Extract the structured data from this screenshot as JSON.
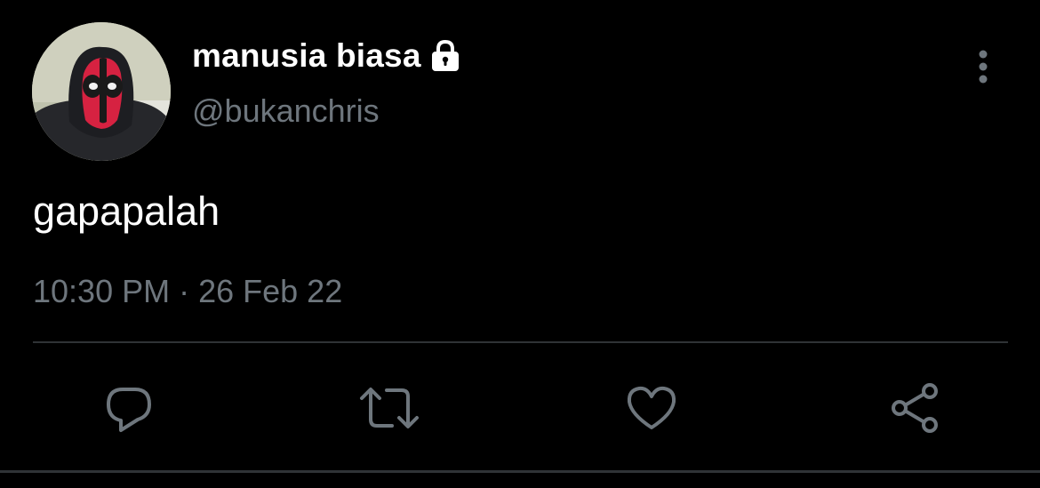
{
  "tweet": {
    "author": {
      "display_name": "manusia biasa",
      "handle": "@bukanchris",
      "verified_icon": "lock-icon",
      "avatar_icon": "avatar-image"
    },
    "text": "gapapalah",
    "time": "10:30 PM",
    "separator": " · ",
    "date": "26 Feb 22",
    "more_icon": "more-vertical-icon"
  },
  "actions": [
    {
      "name": "reply",
      "icon": "reply-icon"
    },
    {
      "name": "retweet",
      "icon": "retweet-icon"
    },
    {
      "name": "like",
      "icon": "heart-icon"
    },
    {
      "name": "share",
      "icon": "share-icon"
    }
  ],
  "colors": {
    "background": "#000000",
    "primary_text": "#ffffff",
    "secondary_text": "#6e767d",
    "divider": "#2f3336",
    "icon": "#6e767d"
  }
}
